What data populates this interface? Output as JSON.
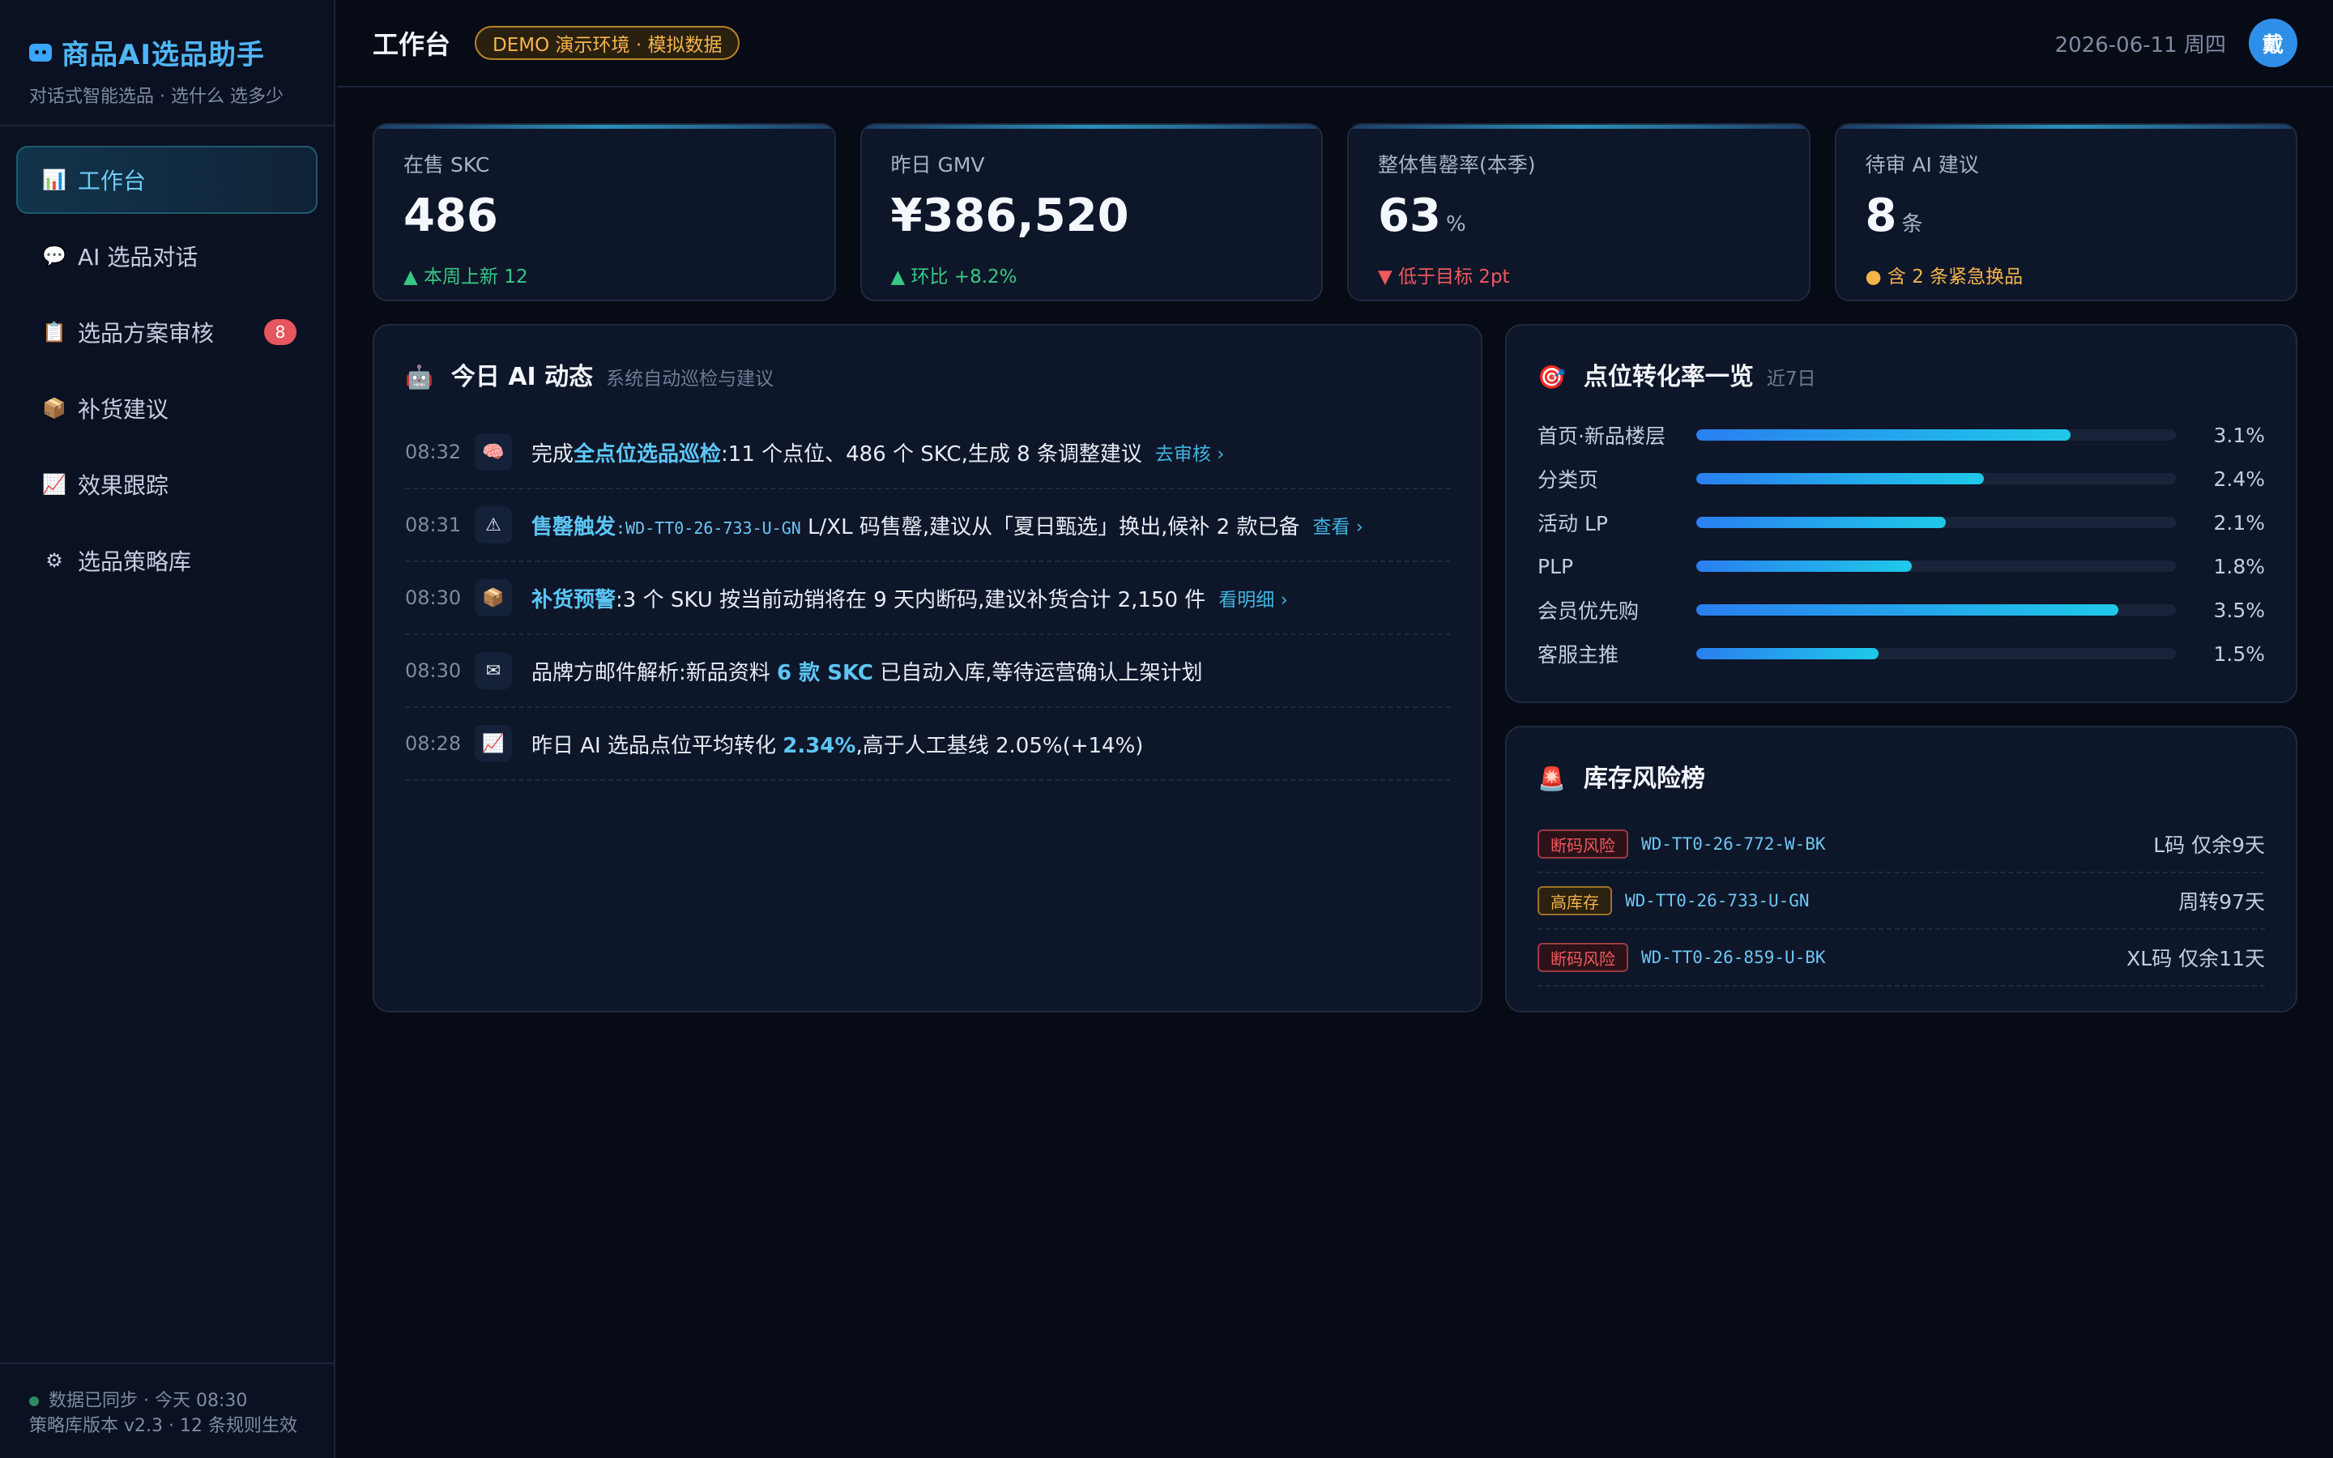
{
  "brand": {
    "title": "商品AI选品助手",
    "subtitle": "对话式智能选品 · 选什么 选多少"
  },
  "nav": [
    {
      "label": "工作台",
      "icon": "bar-chart-icon",
      "active": true
    },
    {
      "label": "AI 选品对话",
      "icon": "speech-bubble-icon"
    },
    {
      "label": "选品方案审核",
      "icon": "clipboard-icon",
      "badge": "8"
    },
    {
      "label": "补货建议",
      "icon": "package-icon"
    },
    {
      "label": "效果跟踪",
      "icon": "trend-chart-icon"
    },
    {
      "label": "选品策略库",
      "icon": "gear-icon"
    }
  ],
  "sidebar_footer": {
    "sync": "数据已同步 · 今天 08:30",
    "version": "策略库版本 v2.3 · 12 条规则生效"
  },
  "header": {
    "title": "工作台",
    "demo_badge": "DEMO 演示环境 · 模拟数据",
    "date": "2026-06-11 周四",
    "avatar": "戴"
  },
  "kpis": [
    {
      "label": "在售 SKC",
      "value": "486",
      "unit": "",
      "delta": "▲ 本周上新 12",
      "tone": "up"
    },
    {
      "label": "昨日 GMV",
      "value": "¥386,520",
      "unit": "",
      "delta": "▲ 环比 +8.2%",
      "tone": "up"
    },
    {
      "label": "整体售罄率(本季)",
      "value": "63",
      "unit": "%",
      "delta": "▼ 低于目标 2pt",
      "tone": "down"
    },
    {
      "label": "待审 AI 建议",
      "value": "8",
      "unit": "条",
      "delta": "● 含 2 条紧急换品",
      "tone": "warn"
    }
  ],
  "activity": {
    "title": "今日 AI 动态",
    "subtitle": "系统自动巡检与建议",
    "items": [
      {
        "time": "08:32",
        "icon": "brain-icon",
        "pre": "完成",
        "hl": "全点位选品巡检",
        "code": "",
        "text": ":11 个点位、486 个 SKC,生成 8 条调整建议",
        "link": "去审核 ›"
      },
      {
        "time": "08:31",
        "icon": "warning-icon",
        "pre": "",
        "hl": "售罄触发",
        "code": ":WD-TT0-26-733-U-GN",
        "text": " L/XL 码售罄,建议从「夏日甄选」换出,候补 2 款已备",
        "link": "查看 ›"
      },
      {
        "time": "08:30",
        "icon": "package-icon",
        "pre": "",
        "hl": "补货预警",
        "code": "",
        "text": ":3 个 SKU 按当前动销将在 9 天内断码,建议补货合计 2,150 件",
        "link": "看明细 ›"
      },
      {
        "time": "08:30",
        "icon": "mail-icon",
        "pre": "品牌方邮件解析:新品资料 ",
        "hl": "6 款 SKC",
        "code": "",
        "text": " 已自动入库,等待运营确认上架计划",
        "link": ""
      },
      {
        "time": "08:28",
        "icon": "trend-chart-icon",
        "pre": "昨日 AI 选品点位平均转化 ",
        "hl": "2.34%",
        "code": "",
        "text": ",高于人工基线 2.05%(+14%)",
        "link": ""
      }
    ]
  },
  "conversion": {
    "title": "点位转化率一览",
    "subtitle": "近7日",
    "rows": [
      {
        "label": "首页·新品楼层",
        "value": "3.1%",
        "fill": 0.78
      },
      {
        "label": "分类页",
        "value": "2.4%",
        "fill": 0.6
      },
      {
        "label": "活动 LP",
        "value": "2.1%",
        "fill": 0.52
      },
      {
        "label": "PLP",
        "value": "1.8%",
        "fill": 0.45
      },
      {
        "label": "会员优先购",
        "value": "3.5%",
        "fill": 0.88
      },
      {
        "label": "客服主推",
        "value": "1.5%",
        "fill": 0.38
      }
    ]
  },
  "risk": {
    "title": "库存风险榜",
    "rows": [
      {
        "tag": "断码风险",
        "tone": "red",
        "code": "WD-TT0-26-772-W-BK",
        "note": "L码 仅余9天"
      },
      {
        "tag": "高库存",
        "tone": "amber",
        "code": "WD-TT0-26-733-U-GN",
        "note": "周转97天"
      },
      {
        "tag": "断码风险",
        "tone": "red",
        "code": "WD-TT0-26-859-U-BK",
        "note": "XL码 仅余11天"
      }
    ]
  }
}
